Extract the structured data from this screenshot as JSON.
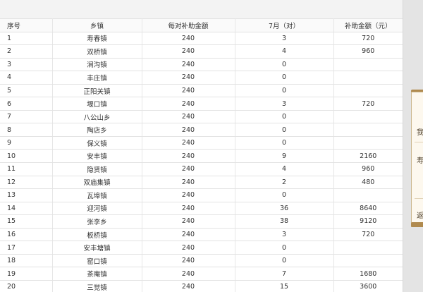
{
  "table": {
    "headers": [
      "序号",
      "乡镇",
      "每对补助金额",
      "7月（对）",
      "补助金额（元）"
    ],
    "rows": [
      [
        "1",
        "寿春镇",
        "240",
        "3",
        "720"
      ],
      [
        "2",
        "双桥镇",
        "240",
        "4",
        "960"
      ],
      [
        "3",
        "涧沟镇",
        "240",
        "0",
        ""
      ],
      [
        "4",
        "丰庄镇",
        "240",
        "0",
        ""
      ],
      [
        "5",
        "正阳关镇",
        "240",
        "0",
        ""
      ],
      [
        "6",
        "堰口镇",
        "240",
        "3",
        "720"
      ],
      [
        "7",
        "八公山乡",
        "240",
        "0",
        ""
      ],
      [
        "8",
        "陶店乡",
        "240",
        "0",
        ""
      ],
      [
        "9",
        "保义镇",
        "240",
        "0",
        ""
      ],
      [
        "10",
        "安丰镇",
        "240",
        "9",
        "2160"
      ],
      [
        "11",
        "隐贤镇",
        "240",
        "4",
        "960"
      ],
      [
        "12",
        "双庙集镇",
        "240",
        "2",
        "480"
      ],
      [
        "13",
        "瓦埠镇",
        "240",
        "0",
        ""
      ],
      [
        "14",
        "迎河镇",
        "240",
        "36",
        "8640"
      ],
      [
        "15",
        "张李乡",
        "240",
        "38",
        "9120"
      ],
      [
        "16",
        "板桥镇",
        "240",
        "3",
        "720"
      ],
      [
        "17",
        "安丰塘镇",
        "240",
        "0",
        ""
      ],
      [
        "18",
        "窑口镇",
        "240",
        "0",
        ""
      ],
      [
        "19",
        "茶庵镇",
        "240",
        "7",
        "1680"
      ],
      [
        "20",
        "三觉镇",
        "240",
        "15",
        "3600"
      ]
    ]
  },
  "side_panel": {
    "chars": [
      "我",
      "寿",
      "返"
    ]
  },
  "colors": {
    "grid_line": "#e3e3e3",
    "text": "#333333",
    "panel_border": "#cbb58c",
    "panel_tab": "#b08a4e"
  }
}
